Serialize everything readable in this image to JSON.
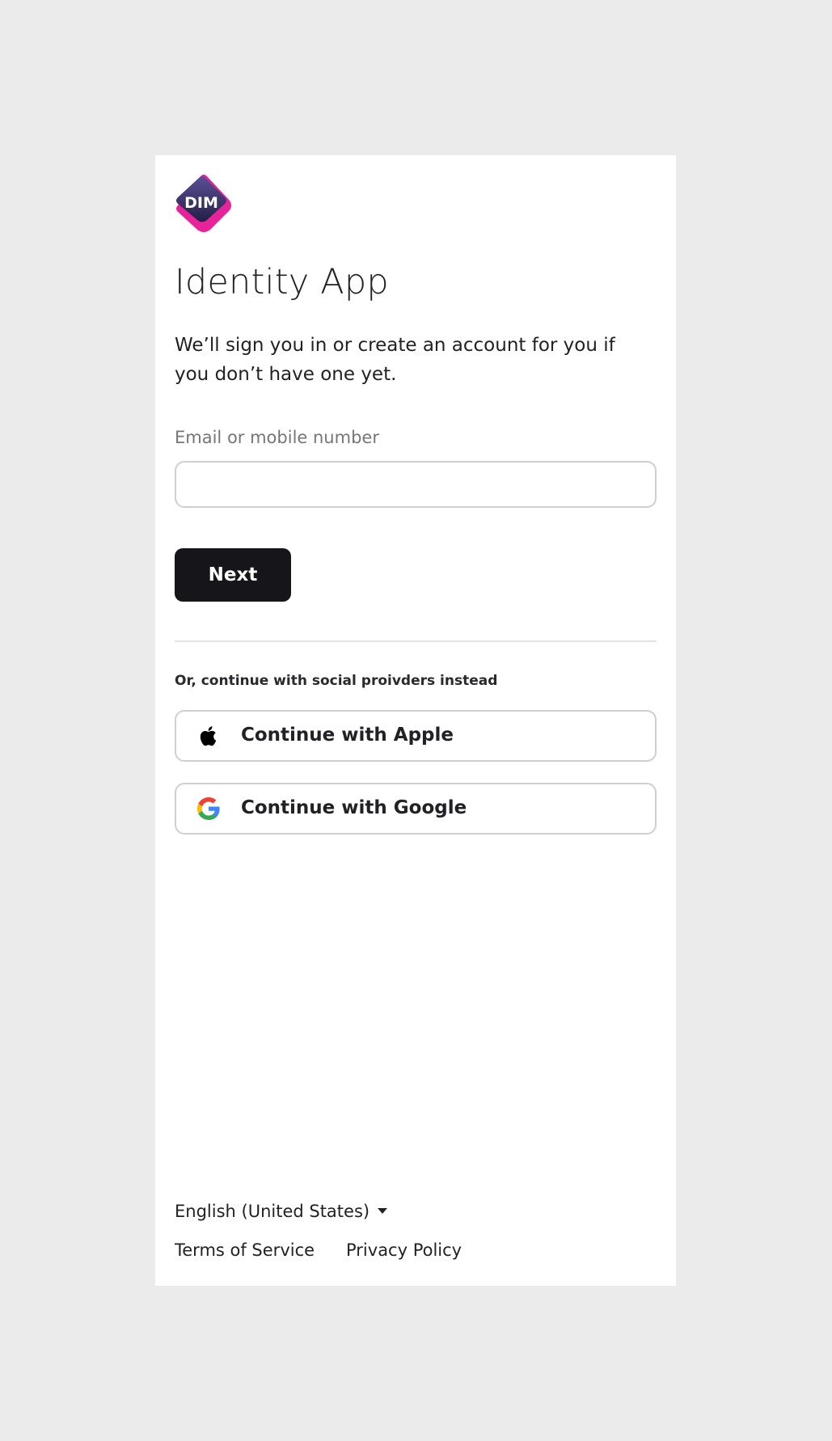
{
  "brand": {
    "logo_text": "DIM",
    "logo_colors": {
      "primary": "#3a3468",
      "accent": "#e8239a"
    }
  },
  "header": {
    "title": "Identity App",
    "subtitle": "We’ll sign you in or create an account for you if you don’t have one yet."
  },
  "form": {
    "email_label": "Email or mobile number",
    "email_value": "",
    "email_placeholder": "",
    "next_label": "Next"
  },
  "social": {
    "heading": "Or, continue with social proivders instead",
    "providers": [
      {
        "label": "Continue with Apple",
        "icon": "apple-icon"
      },
      {
        "label": "Continue with Google",
        "icon": "google-icon"
      }
    ]
  },
  "footer": {
    "language": "English (United States)",
    "terms_label": "Terms of Service",
    "privacy_label": "Privacy Policy"
  },
  "colors": {
    "page_background": "#ebebeb",
    "card_background": "#ffffff",
    "primary_button": "#16161a",
    "border": "#cfcfd3"
  }
}
